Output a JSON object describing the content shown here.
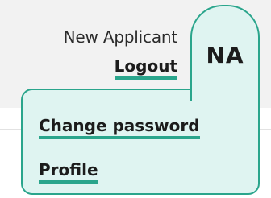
{
  "header": {
    "user_name": "New Applicant",
    "logout_label": "Logout",
    "avatar_initials": "NA"
  },
  "dropdown": {
    "items": [
      {
        "label": "Change password"
      },
      {
        "label": "Profile"
      }
    ]
  },
  "colors": {
    "accent": "#2aa58c",
    "panel_background": "#dff4f1",
    "header_background": "#f2f2f2",
    "text": "#1c1c1c"
  }
}
